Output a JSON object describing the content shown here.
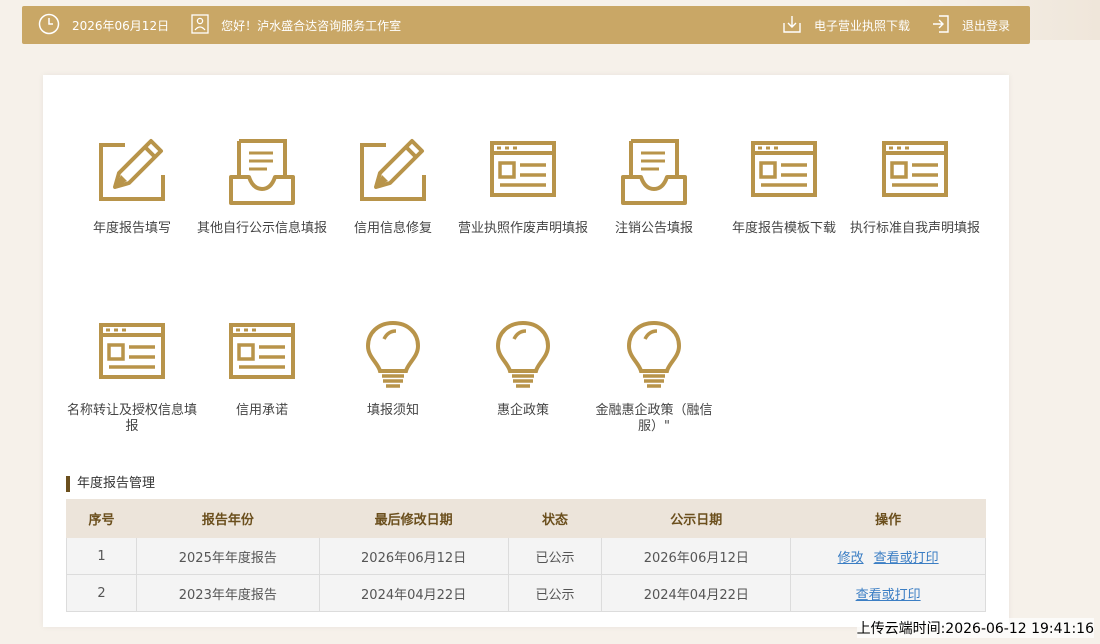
{
  "topbar": {
    "date": "2026年06月12日",
    "greeting": "您好！泸水盛合达咨询服务工作室",
    "download_label": "电子营业执照下载",
    "logout_label": "退出登录"
  },
  "tiles": [
    {
      "label": "年度报告填写",
      "icon": "pencil-form-icon"
    },
    {
      "label": "其他自行公示信息填报",
      "icon": "inbox-document-icon"
    },
    {
      "label": "信用信息修复",
      "icon": "pencil-form-icon"
    },
    {
      "label": "营业执照作废声明填报",
      "icon": "browser-window-icon"
    },
    {
      "label": "注销公告填报",
      "icon": "inbox-document-icon"
    },
    {
      "label": "年度报告模板下载",
      "icon": "browser-window-icon"
    },
    {
      "label": "执行标准自我声明填报",
      "icon": "browser-window-icon"
    },
    {
      "label": "名称转让及授权信息填报",
      "icon": "browser-window-icon"
    },
    {
      "label": "信用承诺",
      "icon": "browser-window-icon"
    },
    {
      "label": "填报须知",
      "icon": "lightbulb-icon"
    },
    {
      "label": "惠企政策",
      "icon": "lightbulb-icon"
    },
    {
      "label": "金融惠企政策（融信服）\"",
      "icon": "lightbulb-icon"
    }
  ],
  "section_title": "年度报告管理",
  "table": {
    "headers": [
      "序号",
      "报告年份",
      "最后修改日期",
      "状态",
      "公示日期",
      "操作"
    ],
    "rows": [
      {
        "index": "1",
        "year": "2025年年度报告",
        "modified": "2026年06月12日",
        "status": "已公示",
        "published": "2026年06月12日",
        "actions": [
          "修改",
          "查看或打印"
        ]
      },
      {
        "index": "2",
        "year": "2023年年度报告",
        "modified": "2024年04月22日",
        "status": "已公示",
        "published": "2024年04月22日",
        "actions": [
          "查看或打印"
        ]
      }
    ]
  },
  "watermark": "上传云端时间:2026-06-12 19:41:16",
  "colors": {
    "gold": "#c9a766",
    "icon_gold": "#b8944a",
    "header_bg": "#ece4da",
    "link": "#3b7ec4"
  }
}
